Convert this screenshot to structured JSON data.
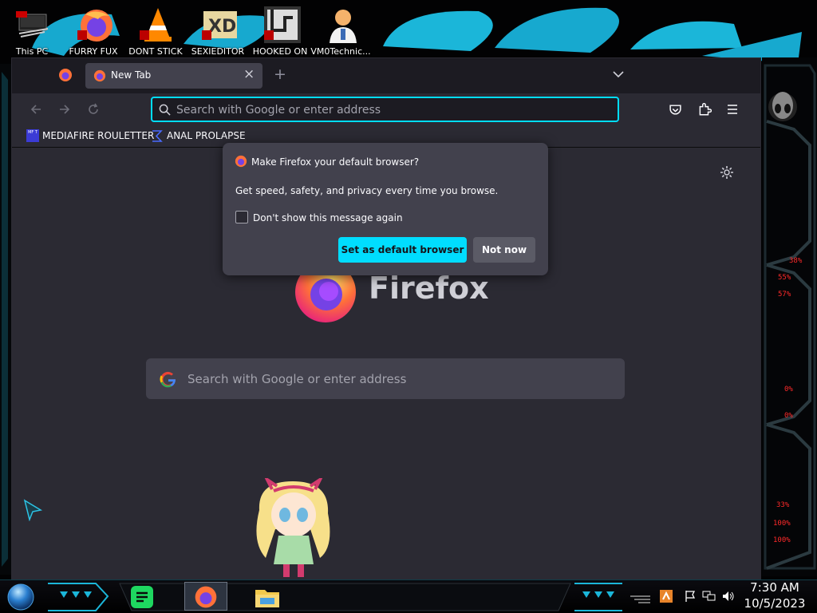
{
  "desktop_icons": [
    {
      "label": "This PC",
      "icon": "this-pc-icon"
    },
    {
      "label": "FURRY FUX",
      "icon": "firefox-shortcut-icon"
    },
    {
      "label": "DONT STICK",
      "icon": "vlc-shortcut-icon"
    },
    {
      "label": "SEXIEDITOR",
      "icon": "xd-editor-shortcut-icon"
    },
    {
      "label": "HOOKED ON",
      "icon": "hooked-on-shortcut-icon"
    },
    {
      "label": "VM0Technic...",
      "icon": "doctor-shortcut-icon"
    }
  ],
  "browser": {
    "tabs": [
      {
        "label": "New Tab",
        "active": true
      }
    ],
    "close_tab": "×",
    "new_tab": "+",
    "url_placeholder": "Search with Google or enter address",
    "bookmarks": [
      {
        "label": "MEDIAFIRE ROULETTER",
        "icon": "mediafire-icon",
        "icon_text": "MF T"
      },
      {
        "label": "ANAL PROLAPSE",
        "icon": "bookmark-sigma-icon"
      }
    ],
    "logo_text": "Firefox",
    "search_placeholder": "Search with Google or enter address"
  },
  "dialog": {
    "title": "Make Firefox your default browser?",
    "body": "Get speed, safety, and privacy every time you browse.",
    "checkbox_label": "Don't show this message again",
    "checkbox_checked": false,
    "primary_button": "Set as default browser",
    "secondary_button": "Not now"
  },
  "gadget": {
    "readouts": [
      "38%",
      "55%",
      "57%",
      "0%",
      "0%",
      "33%",
      "100%",
      "100%"
    ]
  },
  "taskbar": {
    "time": "7:30 AM",
    "date": "10/5/2023",
    "apps": [
      "spotify-icon",
      "firefox-icon",
      "file-explorer-icon"
    ]
  },
  "colors": {
    "accent": "#00ddff",
    "window_bg": "#1c1b22",
    "toolbar_bg": "#2b2a33",
    "dialog_bg": "#42414d",
    "desktop_cyan": "#1bb6d9"
  }
}
